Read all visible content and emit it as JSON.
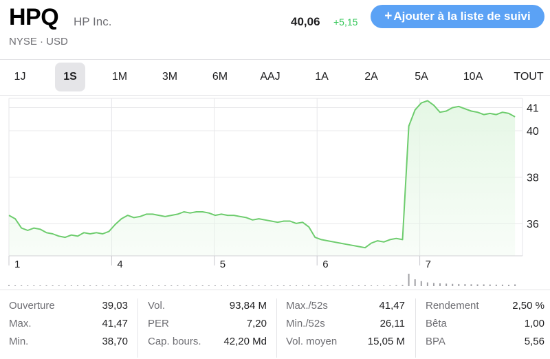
{
  "header": {
    "ticker": "HPQ",
    "company": "HP Inc.",
    "exchange": "NYSE · USD",
    "price": "40,06",
    "change": "+5,15",
    "watch_button": "Ajouter à la liste de suivi",
    "watch_button_plus": "+"
  },
  "tabs": [
    {
      "label": "1J",
      "active": false
    },
    {
      "label": "1S",
      "active": true
    },
    {
      "label": "1M",
      "active": false
    },
    {
      "label": "3M",
      "active": false
    },
    {
      "label": "6M",
      "active": false
    },
    {
      "label": "AAJ",
      "active": false
    },
    {
      "label": "1A",
      "active": false
    },
    {
      "label": "2A",
      "active": false
    },
    {
      "label": "5A",
      "active": false
    },
    {
      "label": "10A",
      "active": false
    },
    {
      "label": "TOUT",
      "active": false
    }
  ],
  "chart_data": {
    "type": "area",
    "x_tick_labels": [
      "1",
      "4",
      "5",
      "6",
      "7"
    ],
    "y_tick_labels": [
      "41",
      "40",
      "38",
      "36"
    ],
    "ylim": [
      34.6,
      41.4
    ],
    "line_color": "#6dcc6d",
    "fill_color": "#e5f7e5",
    "series": [
      {
        "values": [
          36.35,
          36.2,
          35.8,
          35.7,
          35.8,
          35.75,
          35.6,
          35.55,
          35.45,
          35.4,
          35.5,
          35.45,
          35.6,
          35.55,
          35.6,
          35.55,
          35.65,
          35.95,
          36.2,
          36.35,
          36.25,
          36.3,
          36.4,
          36.4,
          36.35,
          36.3,
          36.35,
          36.4,
          36.5,
          36.45,
          36.5,
          36.5,
          36.45,
          36.35,
          36.4,
          36.35,
          36.35,
          36.3,
          36.25,
          36.15,
          36.2,
          36.15,
          36.1,
          36.05,
          36.1,
          36.1,
          36.0,
          36.05,
          35.85,
          35.4,
          35.3,
          35.25,
          35.2,
          35.15,
          35.1,
          35.05,
          35.0,
          34.95,
          35.15,
          35.25,
          35.2,
          35.3,
          35.35,
          35.3,
          40.2,
          40.9,
          41.2,
          41.3,
          41.1,
          40.8,
          40.85,
          41.0,
          41.05,
          40.95,
          40.85,
          40.8,
          40.7,
          40.75,
          40.7,
          40.8,
          40.75,
          40.6
        ]
      }
    ],
    "volume": [
      0.08,
      0.05,
      0.06,
      0.05,
      0.04,
      0.05,
      0.06,
      0.05,
      0.04,
      0.05,
      0.05,
      0.06,
      0.04,
      0.05,
      0.05,
      0.06,
      0.05,
      0.04,
      0.05,
      0.06,
      0.05,
      0.04,
      0.05,
      0.05,
      0.05,
      0.04,
      0.05,
      0.06,
      0.05,
      0.04,
      0.05,
      0.05,
      0.04,
      0.05,
      0.05,
      0.04,
      0.05,
      0.06,
      0.05,
      0.04,
      0.05,
      0.04,
      0.05,
      0.05,
      0.04,
      0.05,
      0.06,
      0.05,
      0.08,
      0.06,
      0.05,
      0.05,
      0.04,
      0.05,
      0.05,
      0.04,
      0.05,
      0.06,
      0.05,
      0.04,
      0.05,
      0.06,
      0.07,
      0.09,
      1.0,
      0.55,
      0.4,
      0.3,
      0.25,
      0.22,
      0.2,
      0.18,
      0.17,
      0.16,
      0.15,
      0.14,
      0.14,
      0.13,
      0.12,
      0.12,
      0.11,
      0.14
    ]
  },
  "stats": {
    "col1": [
      {
        "label": "Ouverture",
        "value": "39,03"
      },
      {
        "label": "Max.",
        "value": "41,47"
      },
      {
        "label": "Min.",
        "value": "38,70"
      }
    ],
    "col2": [
      {
        "label": "Vol.",
        "value": "93,84 M"
      },
      {
        "label": "PER",
        "value": "7,20"
      },
      {
        "label": "Cap. bours.",
        "value": "42,20 Md"
      }
    ],
    "col3": [
      {
        "label": "Max./52s",
        "value": "41,47"
      },
      {
        "label": "Min./52s",
        "value": "26,11"
      },
      {
        "label": "Vol. moyen",
        "value": "15,05 M"
      }
    ],
    "col4": [
      {
        "label": "Rendement",
        "value": "2,50 %"
      },
      {
        "label": "Bêta",
        "value": "1,00"
      },
      {
        "label": "BPA",
        "value": "5,56"
      }
    ]
  }
}
